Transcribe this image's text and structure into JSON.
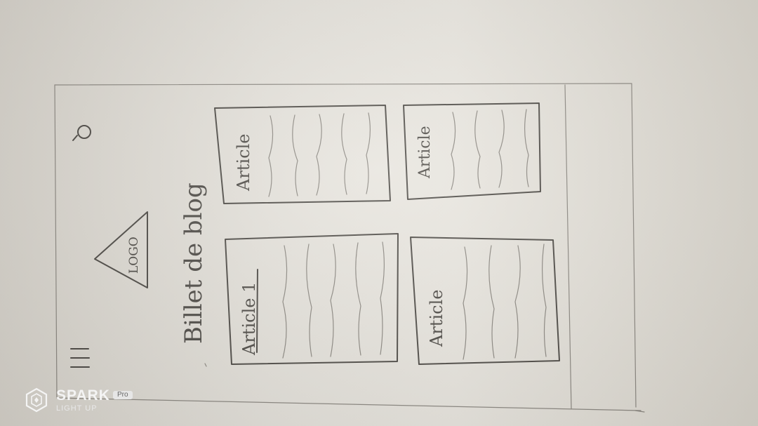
{
  "sketch": {
    "logo_label": "LOGO",
    "page_title": "Billet de blog",
    "articles": [
      {
        "label": "Article 1"
      },
      {
        "label": "Article"
      },
      {
        "label": "Article"
      },
      {
        "label": "Article"
      }
    ]
  },
  "watermark": {
    "brand": "SPARK",
    "badge": "Pro",
    "subtitle": "LIGHT UP"
  },
  "colors": {
    "paper": "#e6e3dc",
    "pencil": "#4a4742",
    "watermark_text": "#f4f4f4"
  }
}
